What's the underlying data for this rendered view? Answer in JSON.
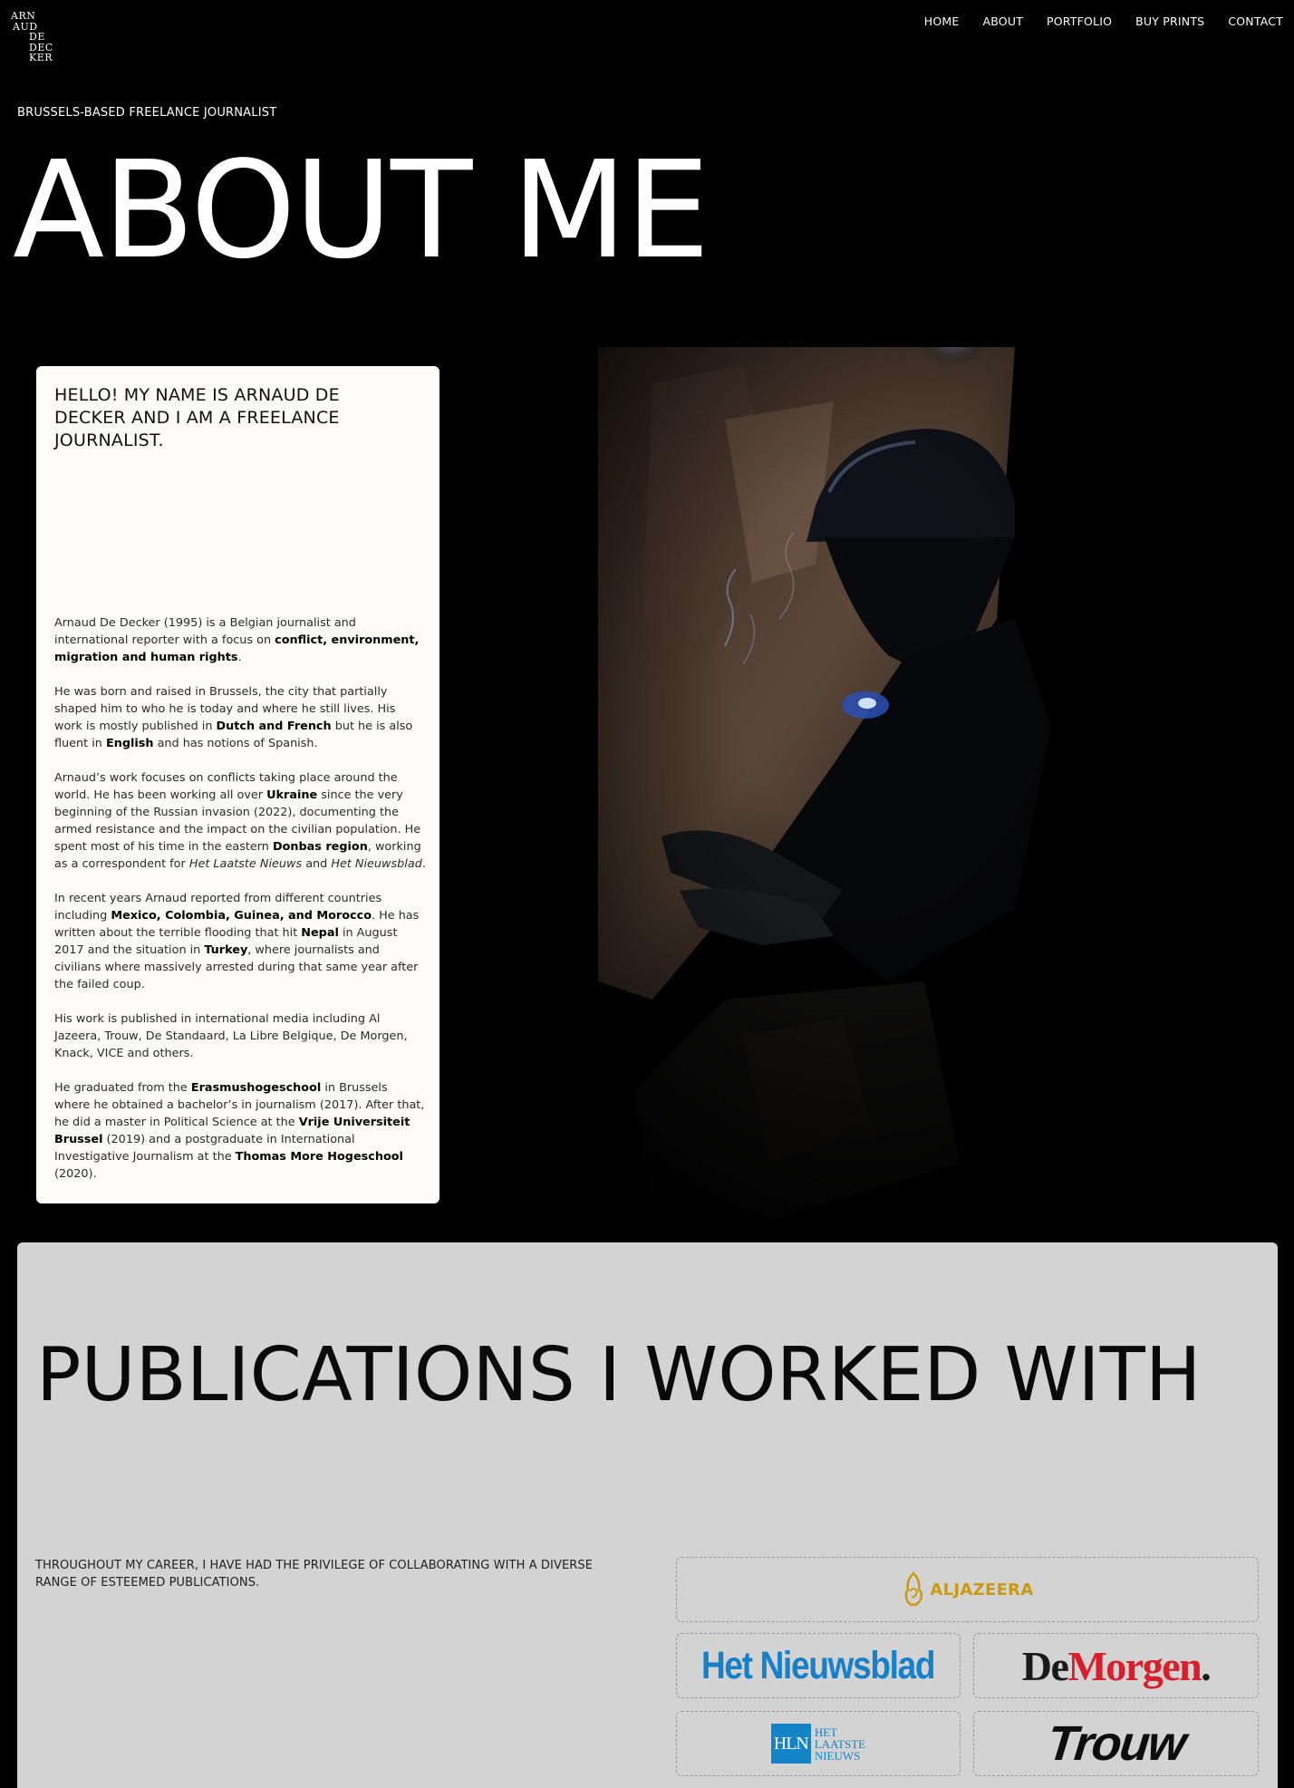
{
  "logo": {
    "lines": [
      "ARN",
      "AUD",
      "DE",
      "DEC",
      "KER"
    ]
  },
  "nav": [
    "HOME",
    "ABOUT",
    "PORTFOLIO",
    "BUY PRINTS",
    "CONTACT"
  ],
  "hero": {
    "tagline": "BRUSSELS-BASED FREELANCE JOURNALIST",
    "title": "ABOUT ME"
  },
  "about": {
    "heading": "HELLO! MY NAME IS ARNAUD DE DECKER AND I AM A FREELANCE JOURNALIST.",
    "p1": {
      "a": "Arnaud De Decker (1995) is a Belgian journalist and international reporter with a focus on ",
      "b": "conflict, environment, migration and human rights",
      "c": "."
    },
    "p2": {
      "a": "He was born and raised in Brussels, the city that partially shaped him to who he is today and where he still lives. His work is mostly published in ",
      "b1": "Dutch and French",
      "c": " but he is also fluent in ",
      "b2": "English",
      "d": " and has notions of Spanish."
    },
    "p3": {
      "a": "Arnaud’s work focuses on conflicts taking place around the world. He has been working all over ",
      "b1": "Ukraine",
      "c": " since the very beginning of the Russian invasion (2022), documenting the armed resistance and the impact on the civilian population. He spent most of his time in the eastern ",
      "b2": "Donbas region",
      "d": ", working as a correspondent for ",
      "i1": "Het Laatste Nieuws",
      "e": " and ",
      "i2": "Het Nieuwsblad",
      "f": "."
    },
    "p4": {
      "a": "In recent years Arnaud reported from different countries including ",
      "b1": "Mexico, Colombia, Guinea, and Morocco",
      "c": ". He has written about the terrible flooding that hit ",
      "b2": "Nepal",
      "d": " in August 2017 and the situation in ",
      "b3": "Turkey",
      "e": ", where journalists and civilians where massively arrested during that same year after the failed coup."
    },
    "p5": "His work is published in international media including Al Jazeera, Trouw, De Standaard, La Libre Belgique, De Morgen, Knack, VICE and others.",
    "p6": {
      "a": "He graduated from the ",
      "b1": "Erasmushogeschool",
      "c": " in Brussels where he obtained a bachelor’s in journalism (2017). After that, he did a master in Political Science at the ",
      "b2": "Vrije Universiteit Brussel",
      "d": " (2019) and a postgraduate in International Investigative Journalism at the ",
      "b3": "Thomas More Hogeschool",
      "e": " (2020)."
    }
  },
  "publications": {
    "title": "PUBLICATIONS I WORKED WITH",
    "intro": "THROUGHOUT MY CAREER, I HAVE HAD THE PRIVILEGE OF COLLABORATING WITH A DIVERSE RANGE OF ESTEEMED PUBLICATIONS.",
    "logos": {
      "aljazeera": "ALJAZEERA",
      "nieuwsblad": "Het Nieuwsblad",
      "demorgen_de": "De",
      "demorgen_morgen": "Morgen",
      "demorgen_dot": ".",
      "hln_box": "HLN",
      "hln_lines": [
        "HET",
        "LAATSTE",
        "NIEUWS"
      ],
      "trouw": "Trouw"
    }
  },
  "colors": {
    "background": "#000000",
    "card": "#fcfbf7",
    "publications_bg": "#d3d3d3",
    "aljazeera_gold": "#c99a12",
    "nieuwsblad_blue": "#1680c8",
    "demorgen_red": "#d81f2b",
    "hln_blue": "#1584c6"
  }
}
